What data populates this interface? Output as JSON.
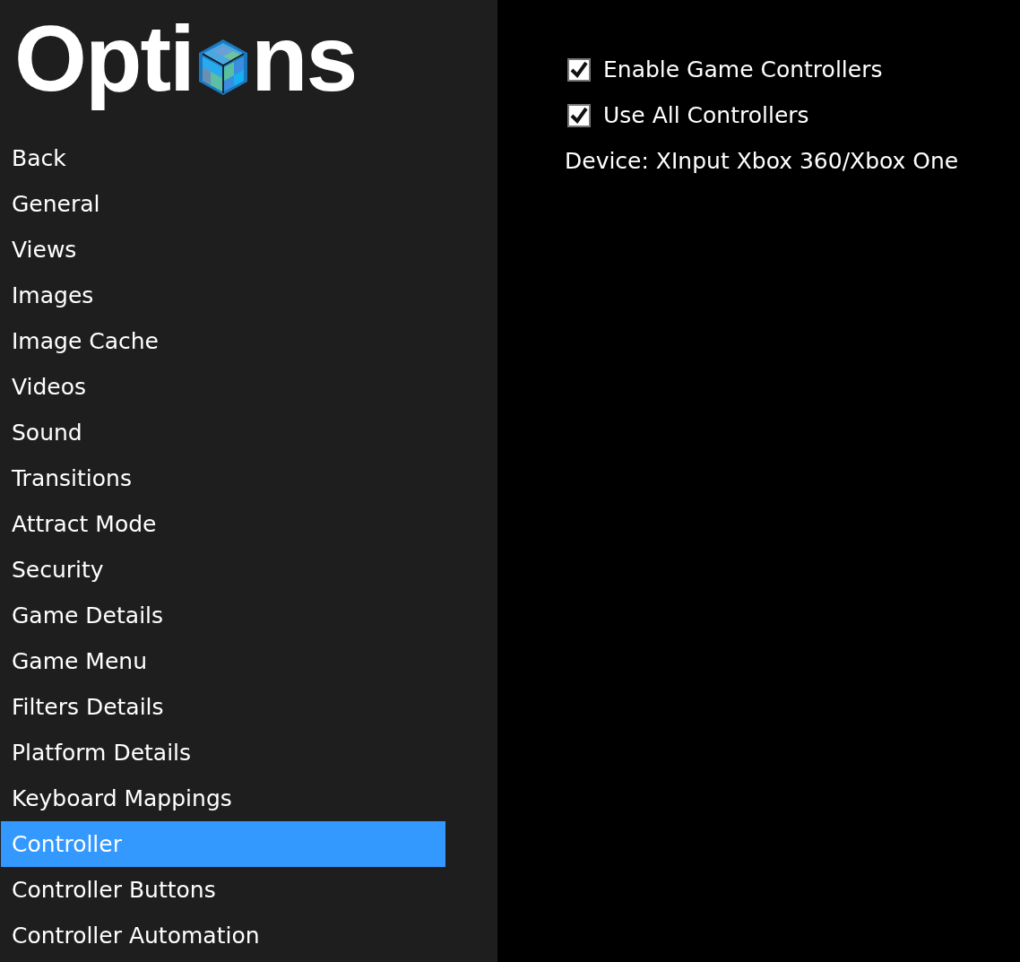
{
  "title": {
    "before_icon": "Opti",
    "after_icon": "ns"
  },
  "menu": [
    {
      "label": "Back",
      "selected": false
    },
    {
      "label": "General",
      "selected": false
    },
    {
      "label": "Views",
      "selected": false
    },
    {
      "label": "Images",
      "selected": false
    },
    {
      "label": "Image Cache",
      "selected": false
    },
    {
      "label": "Videos",
      "selected": false
    },
    {
      "label": "Sound",
      "selected": false
    },
    {
      "label": "Transitions",
      "selected": false
    },
    {
      "label": "Attract Mode",
      "selected": false
    },
    {
      "label": "Security",
      "selected": false
    },
    {
      "label": "Game Details",
      "selected": false
    },
    {
      "label": "Game Menu",
      "selected": false
    },
    {
      "label": "Filters Details",
      "selected": false
    },
    {
      "label": "Platform Details",
      "selected": false
    },
    {
      "label": "Keyboard Mappings",
      "selected": false
    },
    {
      "label": "Controller",
      "selected": true
    },
    {
      "label": "Controller Buttons",
      "selected": false
    },
    {
      "label": "Controller Automation",
      "selected": false
    }
  ],
  "settings": [
    {
      "kind": "checkbox",
      "label": "Enable Game Controllers",
      "checked": true
    },
    {
      "kind": "checkbox",
      "label": "Use All Controllers",
      "checked": true
    },
    {
      "kind": "text",
      "label": "Device: XInput Xbox 360/Xbox One"
    }
  ]
}
